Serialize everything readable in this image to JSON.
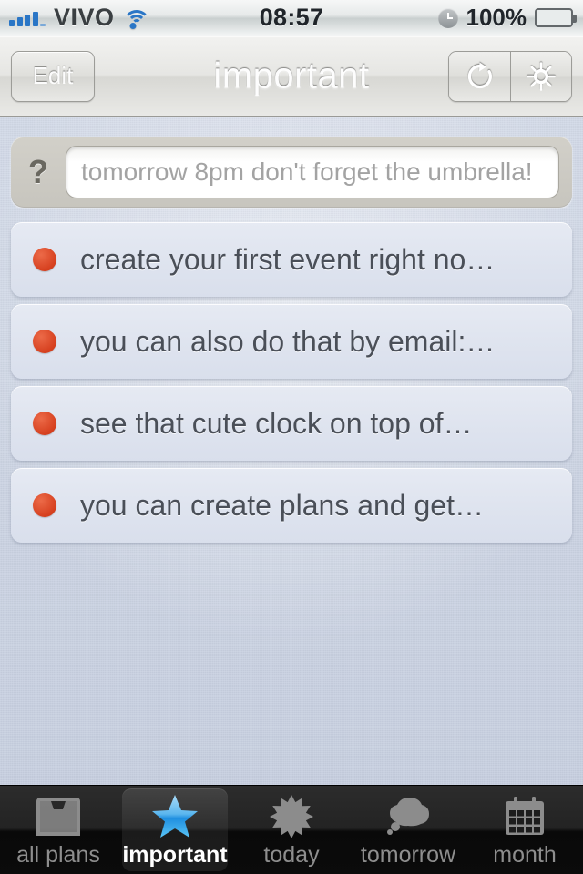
{
  "status_bar": {
    "carrier": "VIVO",
    "time": "08:57",
    "battery_percent": "100%",
    "signal_icon": "signal-bars-icon",
    "wifi_icon": "wifi-icon",
    "alarm_icon": "alarm-clock-icon",
    "battery_icon": "battery-icon"
  },
  "nav_bar": {
    "edit_label": "Edit",
    "title": "important",
    "refresh_icon": "refresh-icon",
    "settings_icon": "gear-icon"
  },
  "add_bar": {
    "help_label": "?",
    "input_value": "",
    "input_placeholder": "tomorrow 8pm don't forget the umbrella!"
  },
  "list": {
    "rows": [
      {
        "bullet_color": "#d6401f",
        "text": "create your first event right no…"
      },
      {
        "bullet_color": "#d6401f",
        "text": "you can also do that by email:…"
      },
      {
        "bullet_color": "#d6401f",
        "text": "see that cute clock on top of…"
      },
      {
        "bullet_color": "#d6401f",
        "text": "you can create plans and get…"
      }
    ]
  },
  "tab_bar": {
    "active_index": 1,
    "tabs": [
      {
        "label": "all plans",
        "icon": "inbox-icon"
      },
      {
        "label": "important",
        "icon": "star-icon"
      },
      {
        "label": "today",
        "icon": "sun-icon"
      },
      {
        "label": "tomorrow",
        "icon": "cloud-icon"
      },
      {
        "label": "month",
        "icon": "calendar-icon"
      }
    ]
  },
  "colors": {
    "accent_blue": "#2a76c6",
    "bullet_red": "#d6401f",
    "background": "#ccd4e3",
    "tab_bar_dark": "#111111",
    "star_blue": "#49a8e8"
  }
}
